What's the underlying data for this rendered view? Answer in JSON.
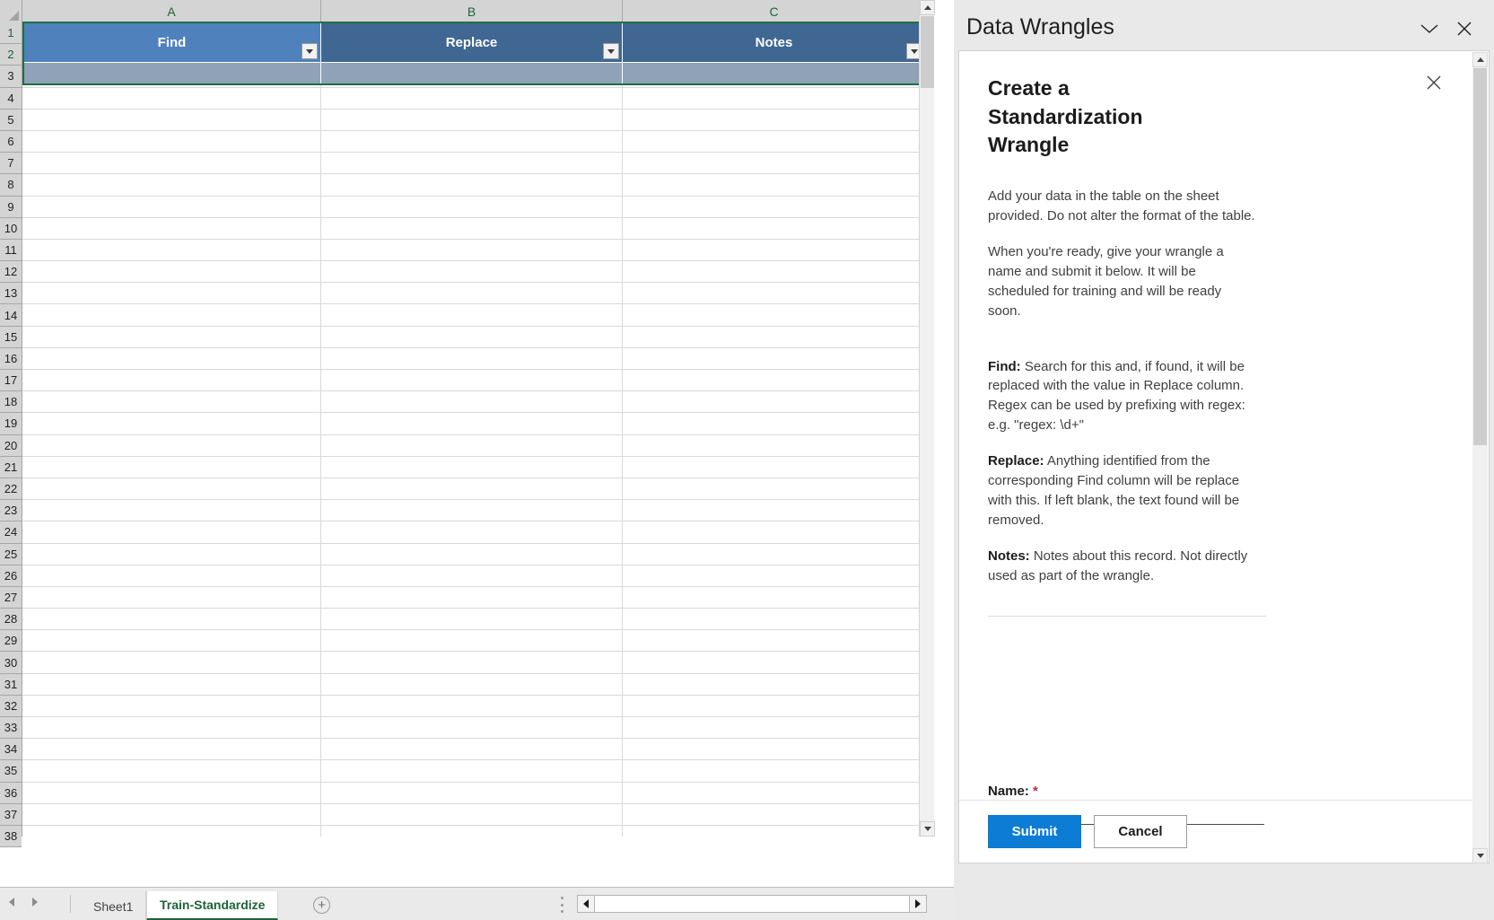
{
  "spreadsheet": {
    "column_headers": [
      "A",
      "B",
      "C"
    ],
    "table_headers": [
      "Find",
      "Replace",
      "Notes"
    ],
    "row_numbers": [
      "1",
      "2",
      "3",
      "4",
      "5",
      "6",
      "7",
      "8",
      "9",
      "10",
      "11",
      "12",
      "13",
      "14",
      "15",
      "16",
      "17",
      "18",
      "19",
      "20",
      "21",
      "22",
      "23",
      "24",
      "25",
      "26",
      "27",
      "28",
      "29",
      "30",
      "31",
      "32",
      "33",
      "34",
      "35",
      "36",
      "37",
      "38"
    ],
    "selected_range": "A1:C2",
    "filter_dropdown_icon": "chevron-down-icon",
    "sheet_tabs": [
      {
        "label": "Sheet1",
        "active": false
      },
      {
        "label": "Train-Standardize",
        "active": true
      }
    ],
    "add_sheet_label": "+",
    "nav_prev_icon": "triangle-left-icon",
    "nav_next_icon": "triangle-right-icon",
    "active_tab_color": "#1d6338",
    "header_fill_selected": "#4f81bd",
    "header_fill": "#3f6792",
    "row2_fill": "#8fa2b8"
  },
  "task_pane": {
    "title": "Data Wrangles",
    "collapse_icon": "chevron-down-icon",
    "close_icon": "close-icon",
    "panel": {
      "close_icon": "close-icon",
      "heading": "Create a Standardization Wrangle",
      "paragraphs": [
        "Add your data in the table on the sheet provided. Do not alter the format of the table.",
        "When you're ready, give your wrangle a name and submit it below. It will be scheduled for training and will be ready soon."
      ],
      "definitions": [
        {
          "term": "Find:",
          "text": " Search for this and, if found, it will be replaced with the value in Replace column. Regex can be used by prefixing with regex: e.g. \"regex: \\d+\""
        },
        {
          "term": "Replace:",
          "text": " Anything identified from the corresponding Find column will be replace with this. If left blank, the text found will be removed."
        },
        {
          "term": "Notes:",
          "text": " Notes about this record. Not directly used as part of the wrangle."
        }
      ],
      "name_field": {
        "label": "Name:",
        "required_mark": "*",
        "value": "",
        "placeholder": ""
      },
      "buttons": {
        "submit": "Submit",
        "cancel": "Cancel"
      },
      "accent_color": "#0c7cd5",
      "required_color": "#b4302e"
    }
  }
}
